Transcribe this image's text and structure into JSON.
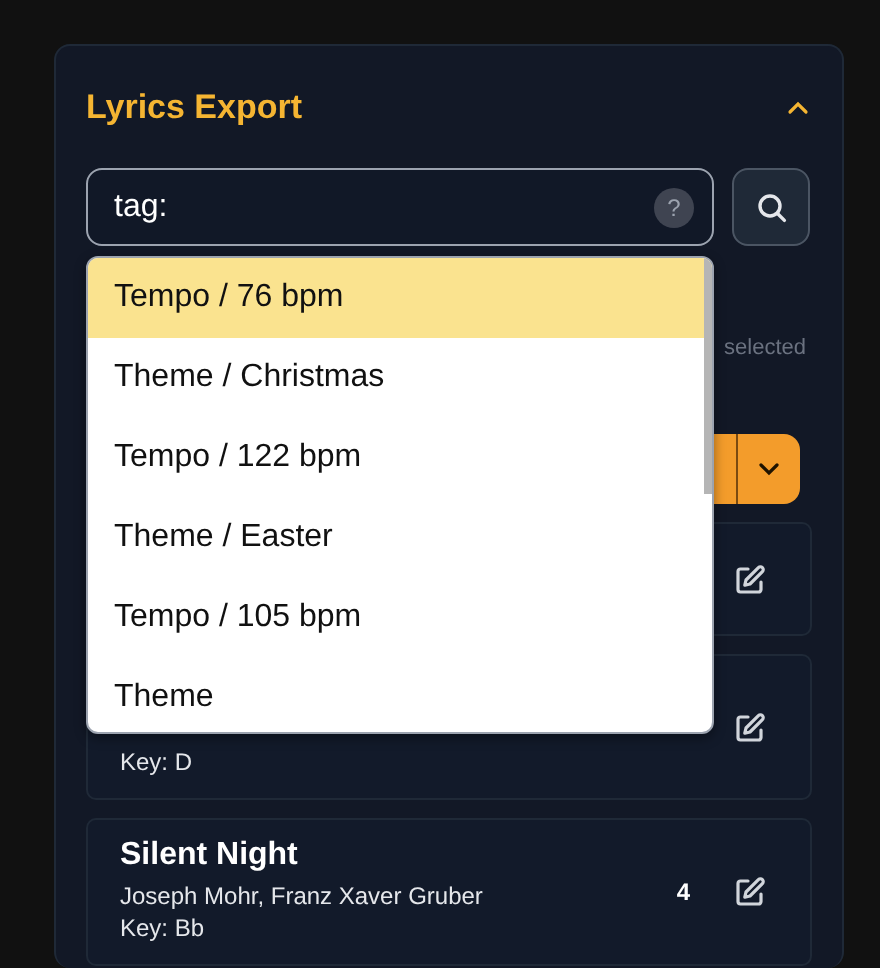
{
  "panel": {
    "title": "Lyrics Export",
    "expanded": true
  },
  "search": {
    "value": "tag:",
    "help": "?"
  },
  "suggestions": [
    {
      "label": "Tempo / 76 bpm",
      "selected": true
    },
    {
      "label": "Theme / Christmas",
      "selected": false
    },
    {
      "label": "Tempo / 122 bpm",
      "selected": false
    },
    {
      "label": "Theme / Easter",
      "selected": false
    },
    {
      "label": "Tempo / 105 bpm",
      "selected": false
    },
    {
      "label": "Theme",
      "selected": false
    }
  ],
  "selection_note": "selected",
  "songs": [
    {
      "editable": true
    },
    {
      "key": "Key: D",
      "editable": true
    },
    {
      "title": "Silent Night",
      "authors": "Joseph Mohr, Franz Xaver Gruber",
      "key": "Key: Bb",
      "count": "4",
      "editable": true
    }
  ]
}
